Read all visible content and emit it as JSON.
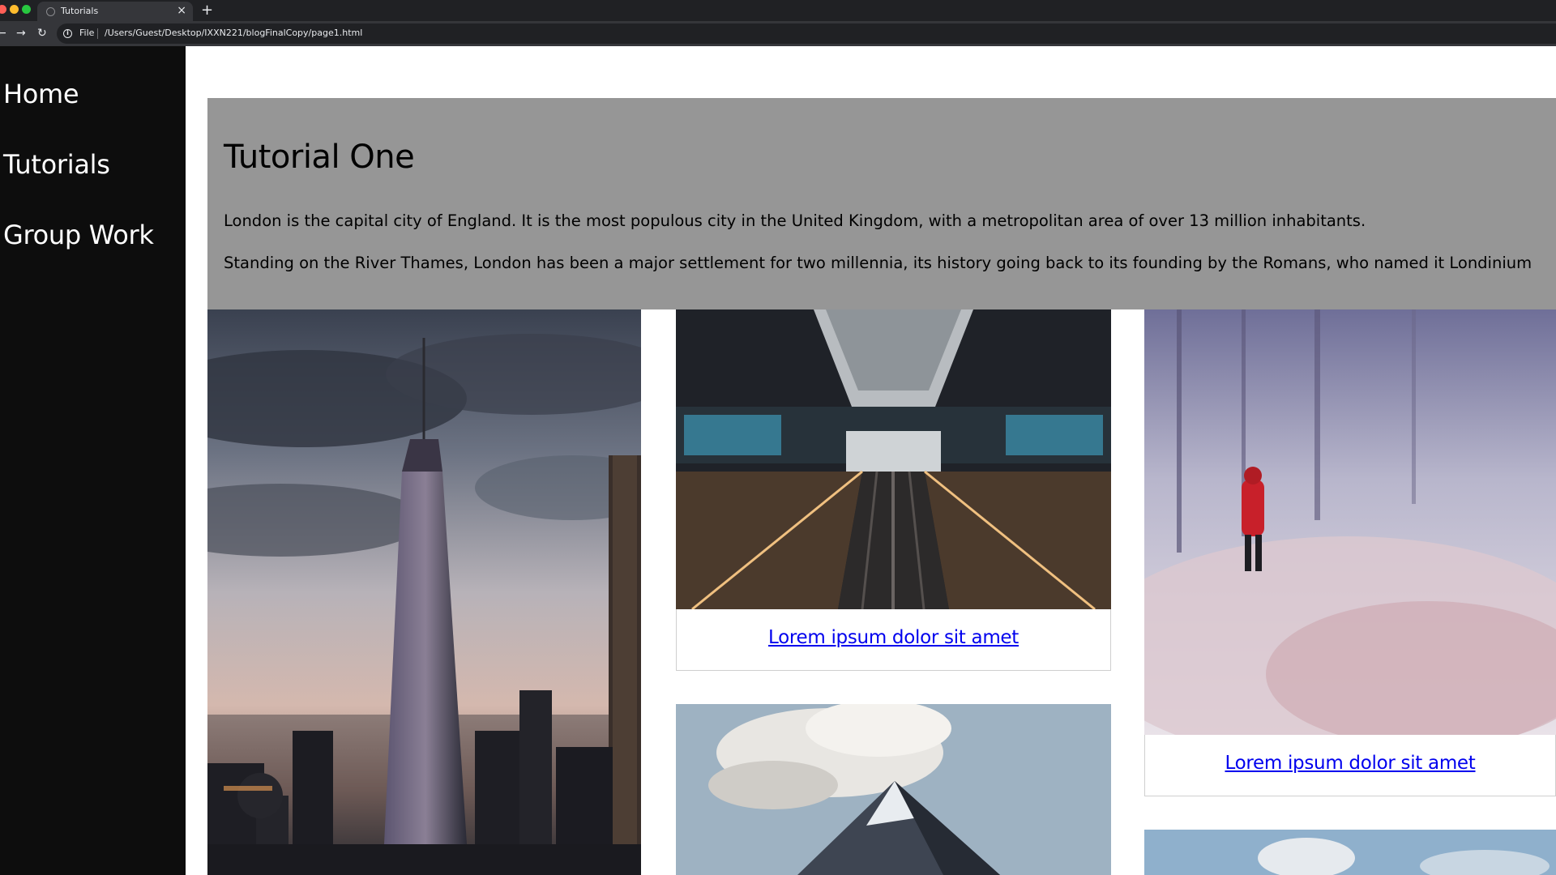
{
  "browser": {
    "tab_title": "Tutorials",
    "tab_close": "×",
    "new_tab": "+",
    "back": "←",
    "forward": "→",
    "reload": "↻",
    "info_glyph": "i",
    "scheme_label": "File",
    "url": "/Users/Guest/Desktop/IXXN221/blogFinalCopy/page1.html",
    "colors": {
      "close": "#ff5f57",
      "minimize": "#febc2e",
      "maximize": "#28c840"
    }
  },
  "sidebar": {
    "items": [
      {
        "label": "Home"
      },
      {
        "label": "Tutorials"
      },
      {
        "label": "Group Work"
      }
    ]
  },
  "hero": {
    "title": "Tutorial One",
    "paragraphs": [
      "London is the capital city of England. It is the most populous city in the United Kingdom, with a metropolitan area of over 13 million inhabitants.",
      "Standing on the River Thames, London has been a major settlement for two millennia, its history going back to its founding by the Romans, who named it Londinium"
    ]
  },
  "gallery": {
    "cards": [
      {
        "image": "city-skyline-at-dusk",
        "caption": ""
      },
      {
        "image": "escalator-in-station",
        "caption": "Lorem ipsum dolor sit amet"
      },
      {
        "image": "person-in-red-coat-snowy-field",
        "caption": "Lorem ipsum dolor sit amet"
      },
      {
        "image": "snowy-mountain-peak-with-clouds",
        "caption": ""
      },
      {
        "image": "sky-and-clouds",
        "caption": ""
      }
    ]
  },
  "colors": {
    "sidebar_bg": "#0d0d0d",
    "hero_bg": "#969696",
    "link": "#0000ee"
  }
}
